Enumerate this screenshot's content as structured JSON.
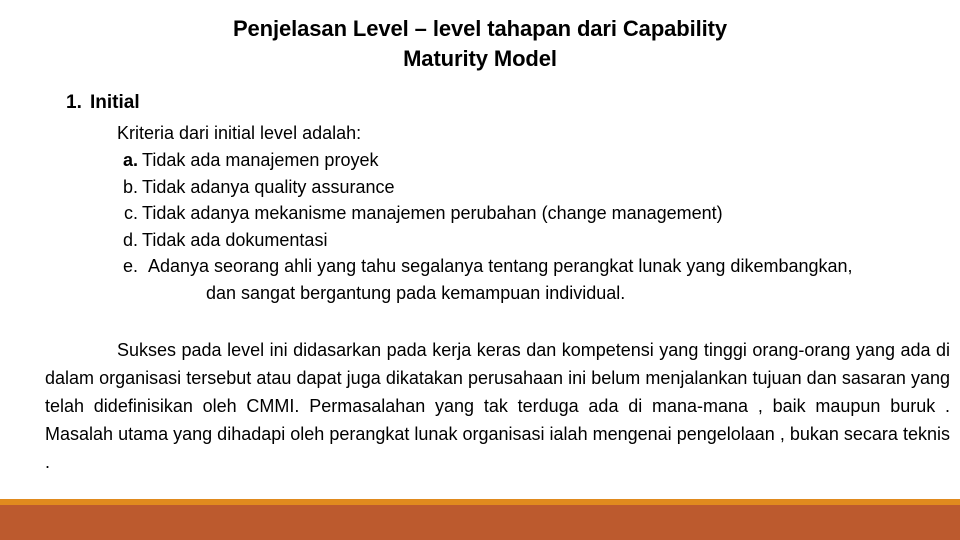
{
  "slide": {
    "title_lines": [
      "Penjelasan Level – level tahapan dari Capability",
      "Maturity Model"
    ],
    "level": {
      "number": "1.",
      "name": "Initial"
    },
    "criteria_intro": "Kriteria dari initial level adalah:",
    "criteria_items": [
      {
        "marker": "a.",
        "text": "Tidak ada manajemen proyek",
        "bold_marker": true
      },
      {
        "marker": "b.",
        "text": "Tidak adanya quality assurance",
        "bold_marker": false
      },
      {
        "marker": "c.",
        "text": "Tidak adanya mekanisme manajemen perubahan (change management)",
        "bold_marker": false
      },
      {
        "marker": "d.",
        "text": "Tidak ada dokumentasi",
        "bold_marker": false
      },
      {
        "marker": "e.",
        "text": "Adanya seorang ahli yang tahu segalanya tentang perangkat lunak yang dikembangkan,",
        "continuation": "dan sangat bergantung pada kemampuan individual.",
        "bold_marker": false
      }
    ],
    "paragraph": "Sukses pada level ini didasarkan pada kerja keras dan kompetensi yang tinggi orang-orang yang ada di dalam organisasi tersebut atau dapat juga dikatakan perusahaan ini belum menjalankan tujuan dan sasaran yang telah didefinisikan oleh CMMI. Permasalahan yang tak terduga ada di mana-mana , baik maupun buruk . Masalah utama yang dihadapi oleh perangkat lunak organisasi ialah mengenai pengelolaan , bukan secara teknis .",
    "colors": {
      "accent_strip": "#E08A1E",
      "accent_band": "#BC5A2E",
      "background": "#FFFFFF",
      "text": "#000000"
    }
  }
}
